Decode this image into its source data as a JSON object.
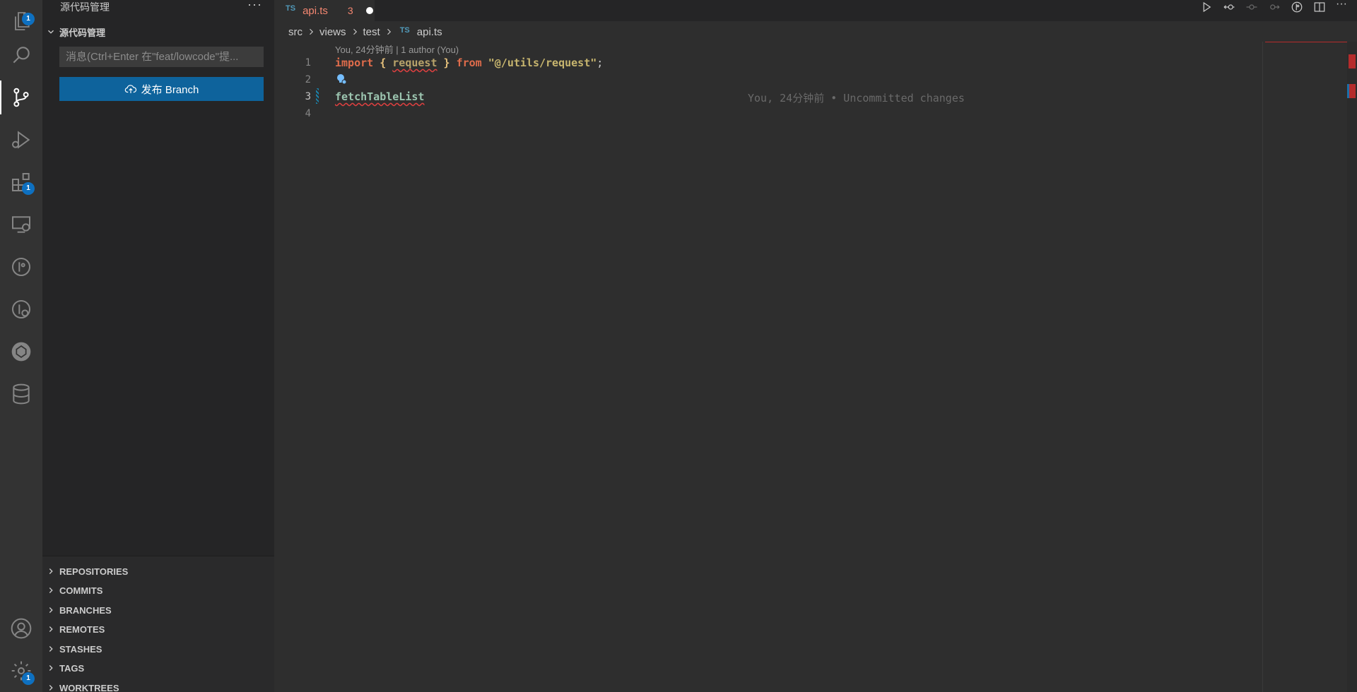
{
  "activity": {
    "explorer_badge": "1",
    "extensions_badge": "1",
    "settings_badge": "1"
  },
  "sidebar": {
    "title": "源代码管理",
    "more_label": "···",
    "section_title": "源代码管理",
    "message_placeholder": "消息(Ctrl+Enter 在\"feat/lowcode\"提...",
    "publish_label": "发布 Branch",
    "tree_items": [
      "REPOSITORIES",
      "COMMITS",
      "BRANCHES",
      "REMOTES",
      "STASHES",
      "TAGS",
      "WORKTREES"
    ]
  },
  "editor": {
    "tab": {
      "lang": "TS",
      "name": "api.ts",
      "problem_count": "3"
    },
    "breadcrumbs": {
      "parts": [
        "src",
        "views",
        "test"
      ],
      "file_lang": "TS",
      "file": "api.ts"
    },
    "codelens": "You, 24分钟前 | 1 author (You)",
    "line_numbers": [
      "1",
      "2",
      "3",
      "4"
    ],
    "code": {
      "l1_import": "import",
      "l1_open": "{",
      "l1_id": "request",
      "l1_close": "}",
      "l1_from": "from",
      "l1_str": "\"@/utils/request\"",
      "l1_semi": ";",
      "l3_fn": "fetchTableList"
    },
    "blame": "You, 24分钟前 • Uncommitted changes"
  },
  "colors": {
    "activity_bg": "#333333",
    "sidebar_bg": "#252526",
    "editor_bg": "#2e2e2e",
    "button_bg": "#0e639c",
    "badge_bg": "#0e70c0",
    "error": "#e04040"
  }
}
